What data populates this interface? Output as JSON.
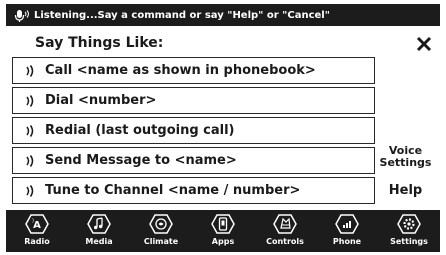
{
  "status": {
    "text": "Listening...Say a command or say \"Help\" or \"Cancel\"",
    "icon": "microphone-listening-icon"
  },
  "panel": {
    "title": "Say Things Like:",
    "close_icon": "close-icon",
    "commands": [
      {
        "label": "Call <name as shown in phonebook>",
        "icon": "voice-command-icon"
      },
      {
        "label": "Dial <number>",
        "icon": "voice-command-icon"
      },
      {
        "label": "Redial (last outgoing call)",
        "icon": "voice-command-icon"
      },
      {
        "label": "Send Message to <name>",
        "icon": "voice-command-icon"
      },
      {
        "label": "Tune to Channel <name / number>",
        "icon": "voice-command-icon"
      }
    ],
    "voice_settings_label_line1": "Voice",
    "voice_settings_label_line2": "Settings",
    "help_label": "Help"
  },
  "nav": {
    "items": [
      {
        "label": "Radio",
        "icon": "radio-icon"
      },
      {
        "label": "Media",
        "icon": "media-icon"
      },
      {
        "label": "Climate",
        "icon": "climate-icon"
      },
      {
        "label": "Apps",
        "icon": "apps-icon"
      },
      {
        "label": "Controls",
        "icon": "controls-icon"
      },
      {
        "label": "Phone",
        "icon": "phone-icon"
      },
      {
        "label": "Settings",
        "icon": "settings-icon"
      }
    ]
  },
  "colors": {
    "bar_background": "#1c1c1c",
    "text_dark": "#1a1a1a",
    "border": "#2a2a2a",
    "background": "#ffffff"
  }
}
